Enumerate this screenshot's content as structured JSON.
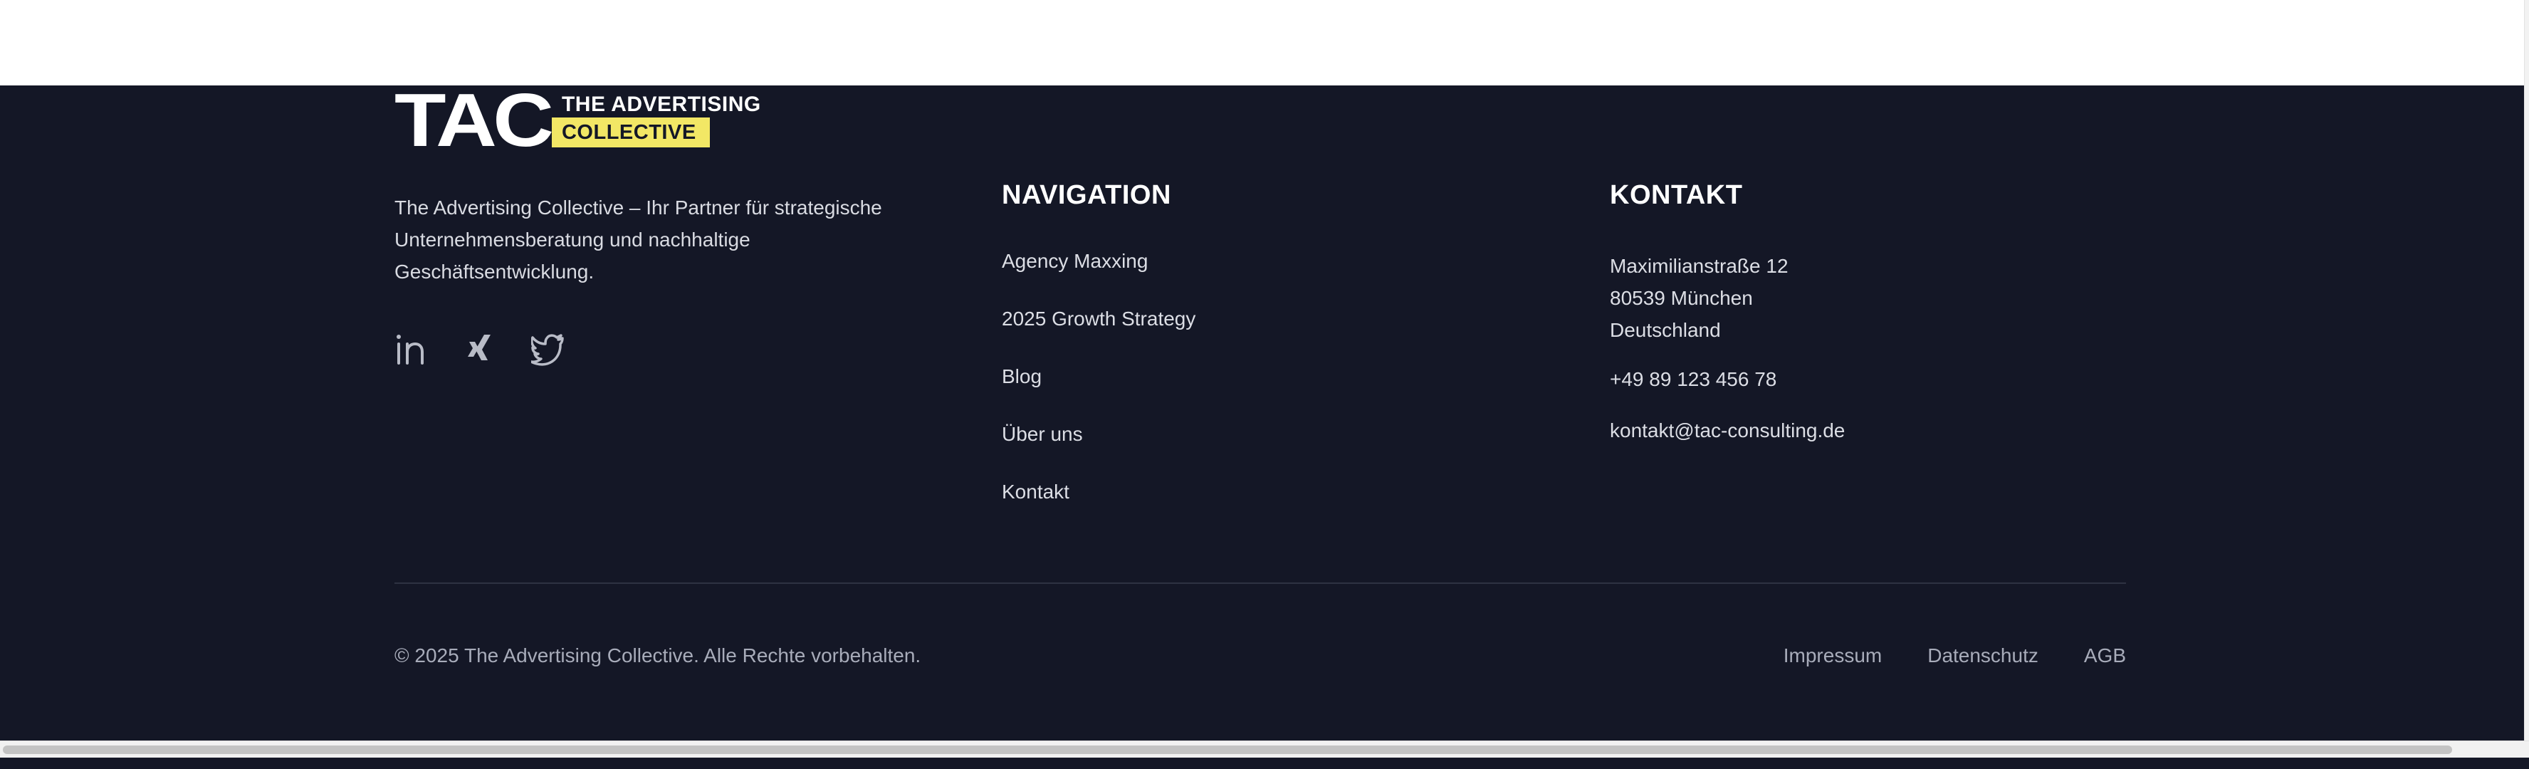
{
  "brand": {
    "logo_mark": "TAC",
    "logo_line1": "THE ADVERTISING",
    "logo_line2": "COLLECTIVE",
    "description": "The Advertising Collective – Ihr Partner für strategische Unternehmensberatung und nachhaltige Geschäftsentwicklung.",
    "accent_color": "#f2e765",
    "social": [
      {
        "icon": "linkedin-icon"
      },
      {
        "icon": "xing-icon"
      },
      {
        "icon": "twitter-icon"
      }
    ]
  },
  "navigation": {
    "title": "NAVIGATION",
    "items": [
      {
        "label": "Agency Maxxing"
      },
      {
        "label": "2025 Growth Strategy"
      },
      {
        "label": "Blog"
      },
      {
        "label": "Über uns"
      },
      {
        "label": "Kontakt"
      }
    ]
  },
  "contact": {
    "title": "KONTAKT",
    "street": "Maximilianstraße 12",
    "city": "80539 München",
    "country": "Deutschland",
    "phone": "+49 89 123 456 78",
    "email": "kontakt@tac-consulting.de"
  },
  "bottom": {
    "copyright": "© 2025 The Advertising Collective. Alle Rechte vorbehalten.",
    "legal": [
      {
        "label": "Impressum"
      },
      {
        "label": "Datenschutz"
      },
      {
        "label": "AGB"
      }
    ]
  },
  "colors": {
    "footer_bg": "#141726",
    "text": "#dcdee5",
    "muted": "#a8acba"
  }
}
